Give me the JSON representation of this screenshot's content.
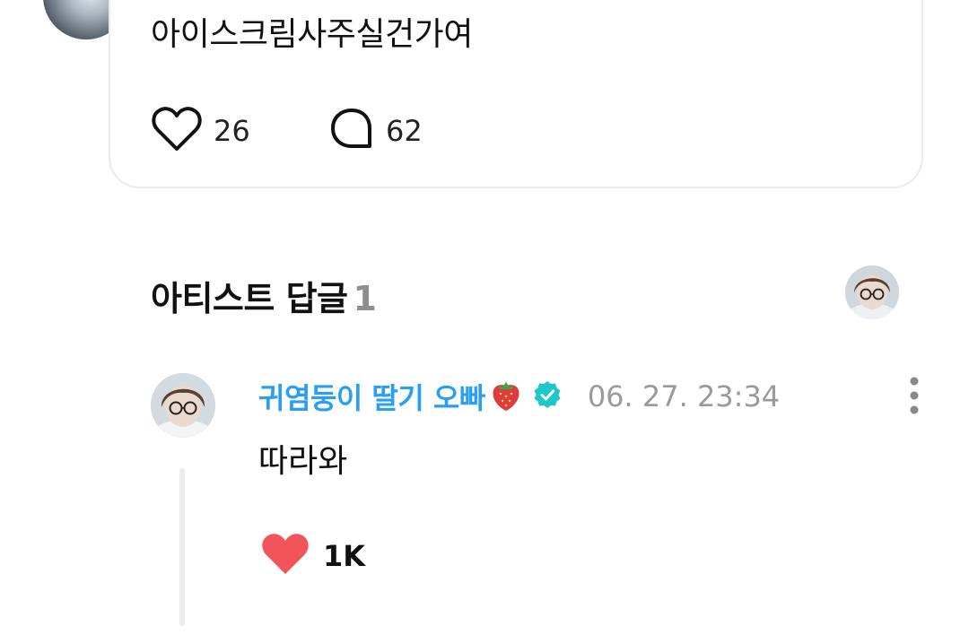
{
  "parent_comment": {
    "text": "아이스크림사주실건가여",
    "like_count": "26",
    "reply_count": "62",
    "icons": {
      "like": "heart-outline-icon",
      "reply": "speech-bubble-icon"
    }
  },
  "artist_replies": {
    "title": "아티스트 답글",
    "count": "1"
  },
  "reply": {
    "author": "귀염둥이 딸기 오빠",
    "timestamp": "06. 27. 23:34",
    "text": "따라와",
    "like_count": "1K",
    "icons": {
      "badge": "strawberry-emoji",
      "verified": "verified-badge-icon",
      "more": "more-vertical-icon",
      "like": "heart-filled-icon"
    }
  },
  "colors": {
    "author_name": "#2a9ff2",
    "verified": "#1ec8c8",
    "like_filled": "#f15559",
    "timestamp": "#9a9a9a"
  }
}
